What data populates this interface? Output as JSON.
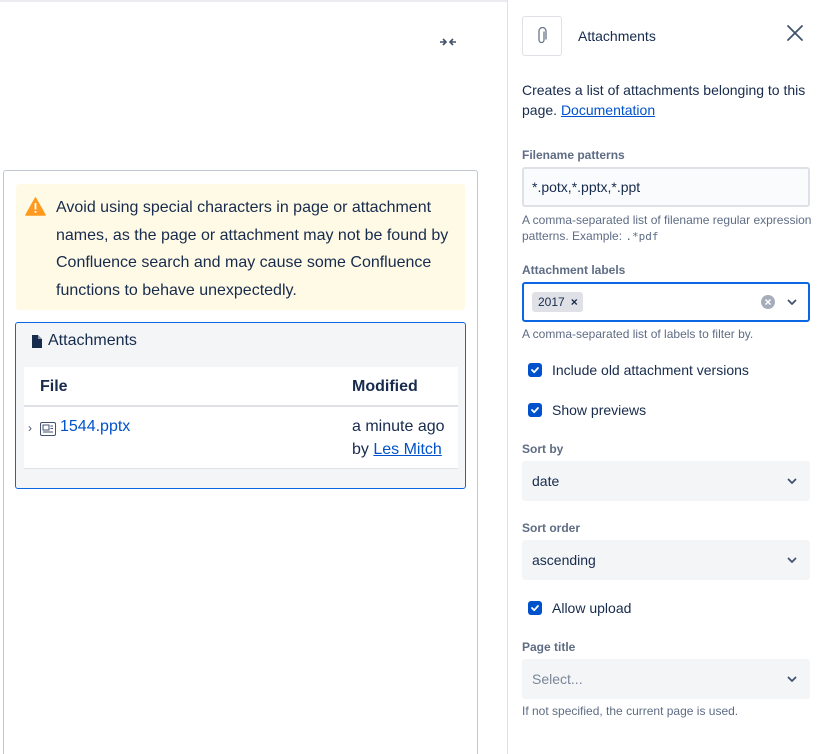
{
  "editor": {
    "warning_text": "Avoid using special characters in page or attachment names, as the page or attachment may not be found by Confluence search and may cause some Confluence functions to behave unexpectedly.",
    "macro": {
      "title": "Attachments",
      "columns": [
        "File",
        "Modified"
      ],
      "rows": [
        {
          "file": "1544.pptx",
          "modified": "a minute ago",
          "by_prefix": "by",
          "author": "Les Mitch"
        }
      ]
    }
  },
  "panel": {
    "title": "Attachments",
    "description": "Creates a list of attachments belonging to this page.",
    "doc_link": "Documentation",
    "filename_patterns": {
      "label": "Filename patterns",
      "value": "*.potx,*.pptx,*.ppt",
      "hint_prefix": "A comma-separated list of filename regular expression patterns. Example:",
      "hint_example": ".*pdf"
    },
    "attachment_labels": {
      "label": "Attachment labels",
      "tags": [
        "2017"
      ],
      "hint": "A comma-separated list of labels to filter by."
    },
    "include_old_versions": {
      "label": "Include old attachment versions",
      "checked": true
    },
    "show_previews": {
      "label": "Show previews",
      "checked": true
    },
    "sort_by": {
      "label": "Sort by",
      "value": "date"
    },
    "sort_order": {
      "label": "Sort order",
      "value": "ascending"
    },
    "allow_upload": {
      "label": "Allow upload",
      "checked": true
    },
    "page_title": {
      "label": "Page title",
      "placeholder": "Select...",
      "hint": "If not specified, the current page is used."
    }
  },
  "colors": {
    "link": "#0052cc",
    "warning_bg": "#fffae6",
    "warning_icon": "#ff991f",
    "focus_border": "#0c66e4"
  }
}
